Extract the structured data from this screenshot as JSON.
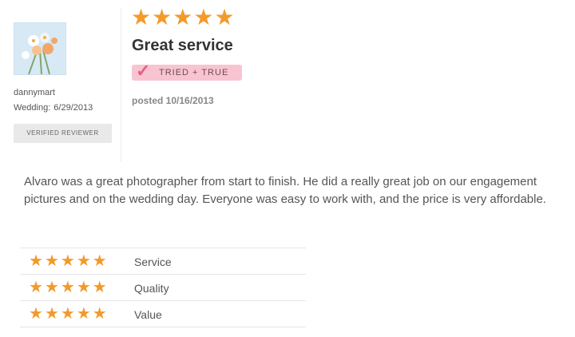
{
  "reviewer": {
    "name": "dannymart",
    "wedding_label": "Wedding:",
    "wedding_date": "6/29/2013",
    "verified_label": "VERIFIED REVIEWER"
  },
  "review": {
    "rating": 5,
    "title": "Great service",
    "badge_label": "TRIED + TRUE",
    "posted": "posted 10/16/2013",
    "body": "Alvaro was a great photographer from start to finish. He did a really great job on our engagement pictures and on the wedding day. Everyone was easy to work with, and the price is very affordable."
  },
  "ratings": [
    {
      "label": "Service",
      "rating": 5
    },
    {
      "label": "Quality",
      "rating": 5
    },
    {
      "label": "Value",
      "rating": 5
    }
  ],
  "colors": {
    "star": "#f39a2b",
    "badge_bg": "#f9c4d2",
    "badge_check": "#e85d86"
  },
  "icons": {
    "star": "star-icon",
    "check": "checkmark-icon"
  }
}
